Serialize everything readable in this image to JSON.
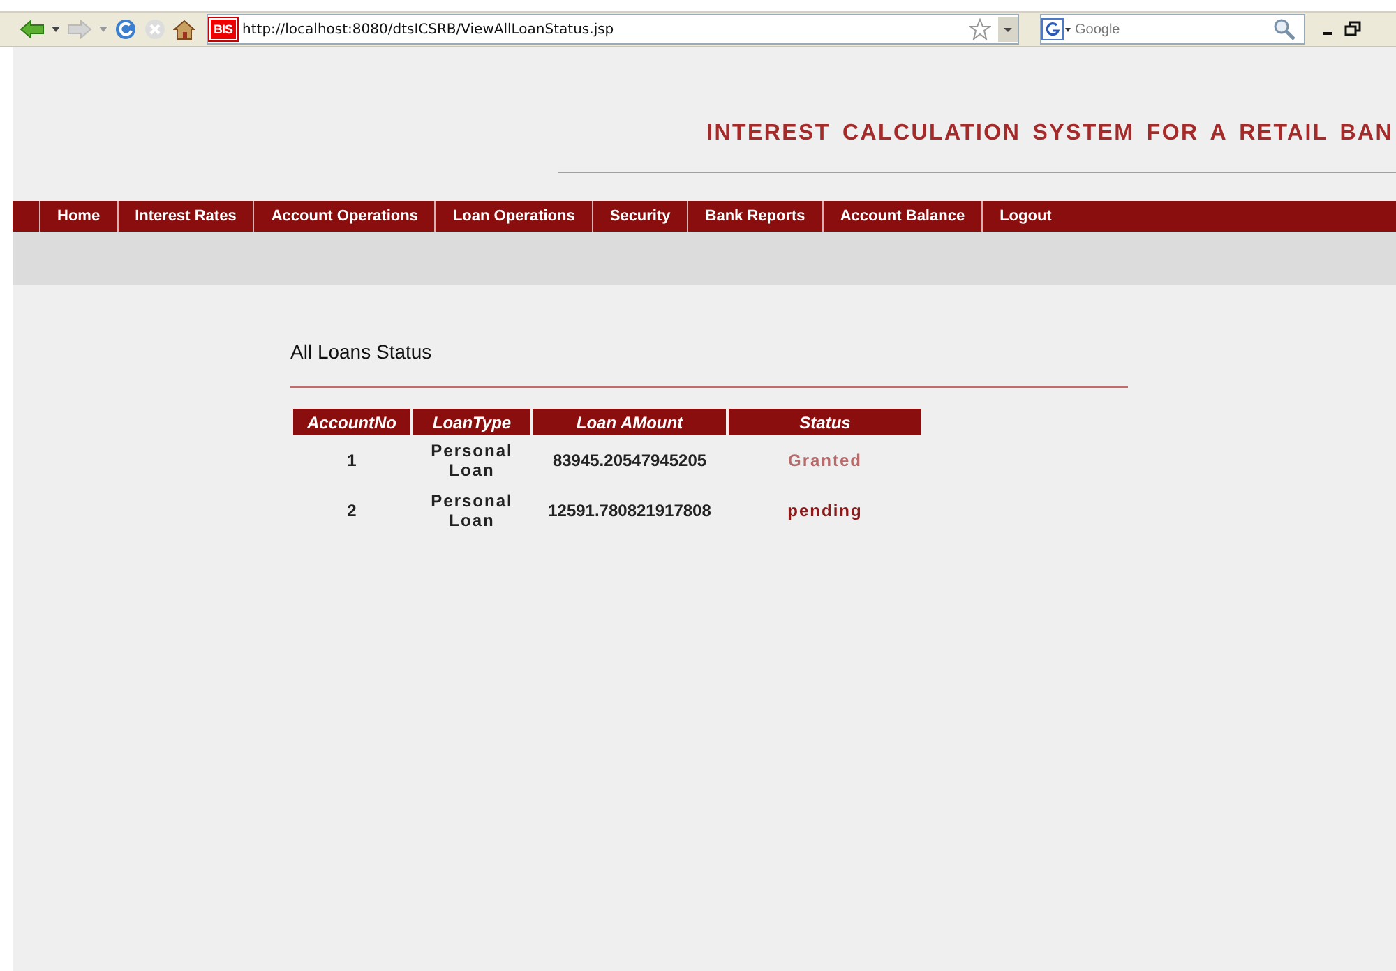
{
  "browser": {
    "favicon_text": "BIS",
    "address": "http://localhost:8080/dtsICSRB/ViewAllLoanStatus.jsp",
    "search_placeholder": "Google"
  },
  "header": {
    "title": "INTEREST CALCULATION SYSTEM FOR A RETAIL BAN"
  },
  "nav": [
    "Home",
    "Interest Rates",
    "Account Operations",
    "Loan Operations",
    "Security",
    "Bank Reports",
    "Account Balance",
    "Logout"
  ],
  "page": {
    "heading": "All Loans Status"
  },
  "table": {
    "columns": [
      "AccountNo",
      "LoanType",
      "Loan AMount",
      "Status"
    ],
    "rows": [
      {
        "account_no": "1",
        "loan_type": "Personal Loan",
        "amount": "83945.20547945205",
        "status": "Granted",
        "color": "#b86a6a"
      },
      {
        "account_no": "2",
        "loan_type": "Personal Loan",
        "amount": "12591.780821917808",
        "status": "pending",
        "color": "#8b1a1a"
      }
    ]
  }
}
